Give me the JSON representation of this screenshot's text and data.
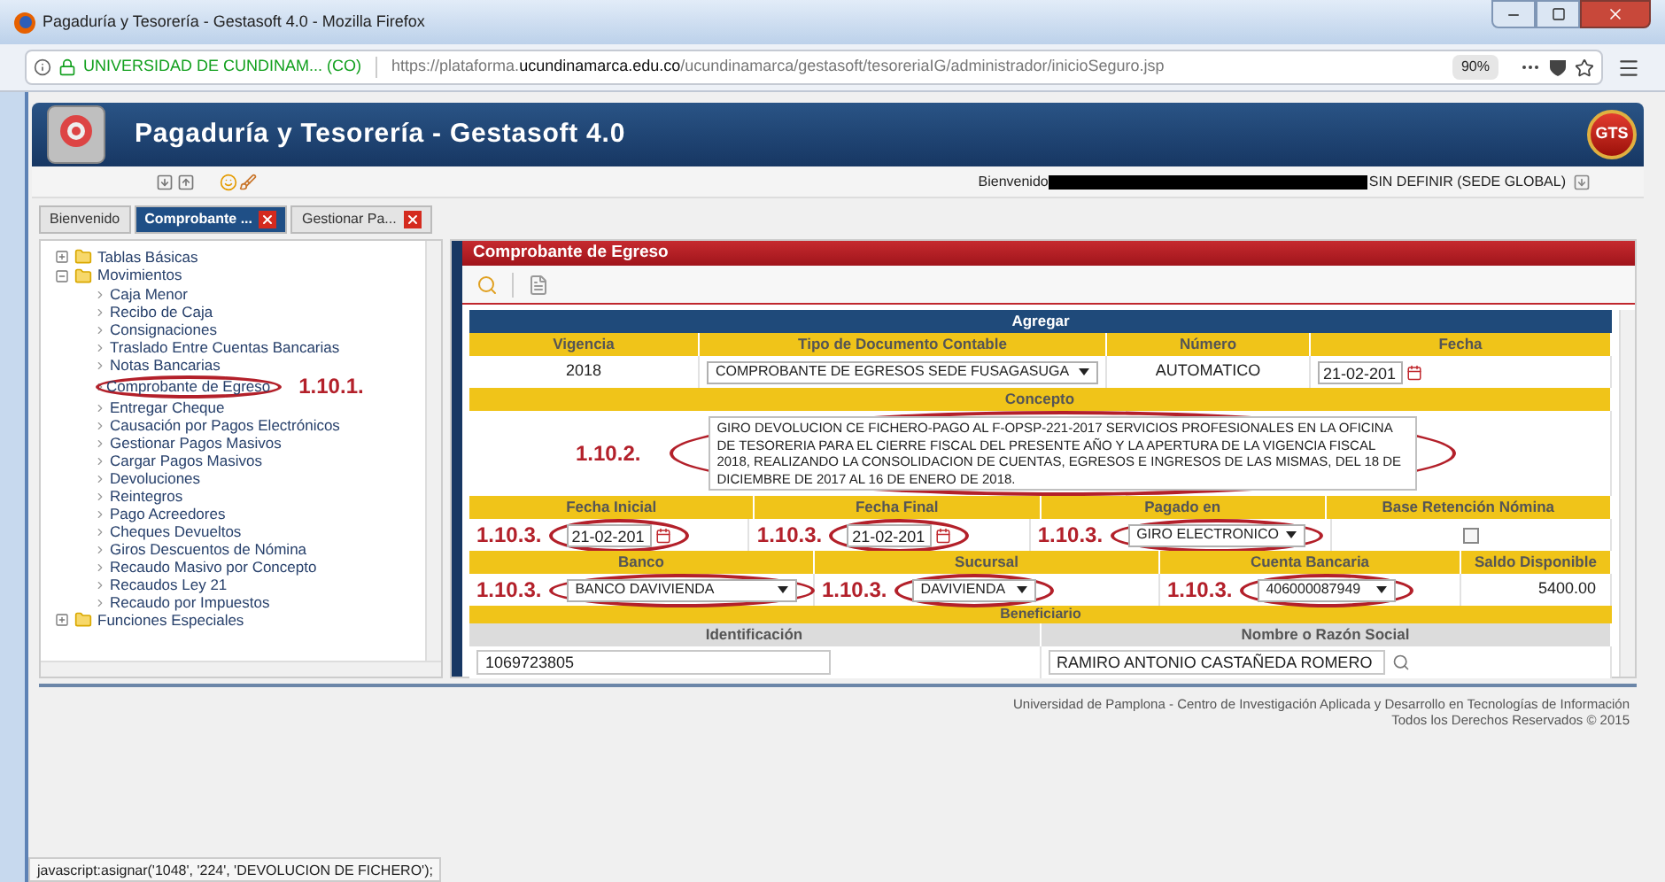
{
  "window": {
    "title": "Pagaduría y Tesorería - Gestasoft 4.0 - Mozilla Firefox"
  },
  "url_bar": {
    "site": "UNIVERSIDAD DE CUNDINAM... (CO)",
    "url_prefix": "https://plataforma.",
    "url_domain": "ucundinamarca.edu.co",
    "url_path": "/ucundinamarca/gestasoft/tesoreriaIG/administrador/inicioSeguro.jsp",
    "zoom": "90%"
  },
  "app": {
    "title": "Pagaduría y Tesorería - Gestasoft 4.0",
    "logo": "GTS",
    "welcome": "Bienvenido",
    "sede": "SIN DEFINIR (SEDE GLOBAL)"
  },
  "tabs": [
    {
      "label": "Bienvenido",
      "selected": false,
      "closable": false
    },
    {
      "label": "Comprobante ...",
      "selected": true,
      "closable": true
    },
    {
      "label": "Gestionar Pa...",
      "selected": false,
      "closable": true
    }
  ],
  "tree": [
    {
      "kind": "folder",
      "label": "Tablas Básicas",
      "expanded": false
    },
    {
      "kind": "folder",
      "label": "Movimientos",
      "expanded": true,
      "children": [
        {
          "label": "Caja Menor"
        },
        {
          "label": "Recibo de Caja"
        },
        {
          "label": "Consignaciones"
        },
        {
          "label": "Traslado Entre Cuentas Bancarias"
        },
        {
          "label": "Notas Bancarias"
        },
        {
          "label": "Comprobante de Egreso",
          "annotation": "1.10.1."
        },
        {
          "label": "Entregar Cheque"
        },
        {
          "label": "Causación por Pagos Electrónicos"
        },
        {
          "label": "Gestionar Pagos Masivos"
        },
        {
          "label": "Cargar Pagos Masivos"
        },
        {
          "label": "Devoluciones"
        },
        {
          "label": "Reintegros"
        },
        {
          "label": "Pago Acreedores"
        },
        {
          "label": "Cheques Devueltos"
        },
        {
          "label": "Giros Descuentos de Nómina"
        },
        {
          "label": "Recaudo Masivo por Concepto"
        },
        {
          "label": "Recaudos Ley 21"
        },
        {
          "label": "Recaudo por Impuestos"
        }
      ]
    },
    {
      "kind": "folder",
      "label": "Funciones Especiales",
      "expanded": false
    }
  ],
  "panel": {
    "title": "Comprobante de Egreso",
    "section": "Agregar",
    "groups": [
      {
        "kind": "fields",
        "fields": [
          {
            "label": "Vigencia",
            "kind": "text",
            "value": "2018"
          },
          {
            "label": "Tipo de Documento Contable",
            "kind": "select",
            "value": "COMPROBANTE DE EGRESOS SEDE FUSAGASUGA"
          },
          {
            "label": "Número",
            "kind": "text",
            "value": "AUTOMATICO"
          },
          {
            "label": "Fecha",
            "kind": "date",
            "value": "21-02-201"
          }
        ]
      },
      {
        "kind": "fields",
        "fields": [
          {
            "label": "Concepto",
            "kind": "textarea",
            "annotation": "1.10.2.",
            "value": "GIRO DEVOLUCION CE FICHERO-PAGO AL F-OPSP-221-2017 SERVICIOS PROFESIONALES EN LA OFICINA DE TESORERIA PARA EL CIERRE FISCAL DEL PRESENTE AÑO Y LA APERTURA DE LA VIGENCIA FISCAL 2018, REALIZANDO LA CONSOLIDACION DE CUENTAS, EGRESOS E INGRESOS DE LAS MISMAS, DEL 18 DE DICIEMBRE DE 2017 AL 16 DE ENERO DE 2018."
          }
        ]
      },
      {
        "kind": "fields",
        "fields": [
          {
            "label": "Fecha Inicial",
            "kind": "date",
            "annotation": "1.10.3.",
            "value": "21-02-201"
          },
          {
            "label": "Fecha Final",
            "kind": "date",
            "annotation": "1.10.3.",
            "value": "21-02-201"
          },
          {
            "label": "Pagado en",
            "kind": "select",
            "annotation": "1.10.3.",
            "value": "GIRO ELECTRONICO"
          },
          {
            "label": "Base Retención Nómina",
            "kind": "checkbox",
            "checked": false
          }
        ]
      },
      {
        "kind": "fields",
        "fields": [
          {
            "label": "Banco",
            "kind": "select",
            "annotation": "1.10.3.",
            "value": "BANCO DAVIVIENDA"
          },
          {
            "label": "Sucursal",
            "kind": "select",
            "annotation": "1.10.3.",
            "value": "DAVIVIENDA"
          },
          {
            "label": "Cuenta Bancaria",
            "kind": "select",
            "annotation": "1.10.3.",
            "value": "406000087949"
          },
          {
            "label": "Saldo Disponible",
            "kind": "amount",
            "value": "5400.00"
          }
        ]
      },
      {
        "kind": "section",
        "label": "Beneficiario"
      },
      {
        "kind": "subfields",
        "fields": [
          {
            "label": "Identificación",
            "kind": "input",
            "value": "1069723805"
          },
          {
            "label": "Nombre o Razón Social",
            "kind": "search_input",
            "value": "RAMIRO ANTONIO CASTAÑEDA ROMERO"
          }
        ]
      }
    ]
  },
  "footer": {
    "line_1": "Universidad de Pamplona - Centro de Investigación Aplicada y Desarrollo en Tecnologías de Información",
    "line_2": "Todos los Derechos Reservados © 2015"
  },
  "status_bar": "javascript:asignar('1048', '224', 'DEVOLUCION DE FICHERO');"
}
